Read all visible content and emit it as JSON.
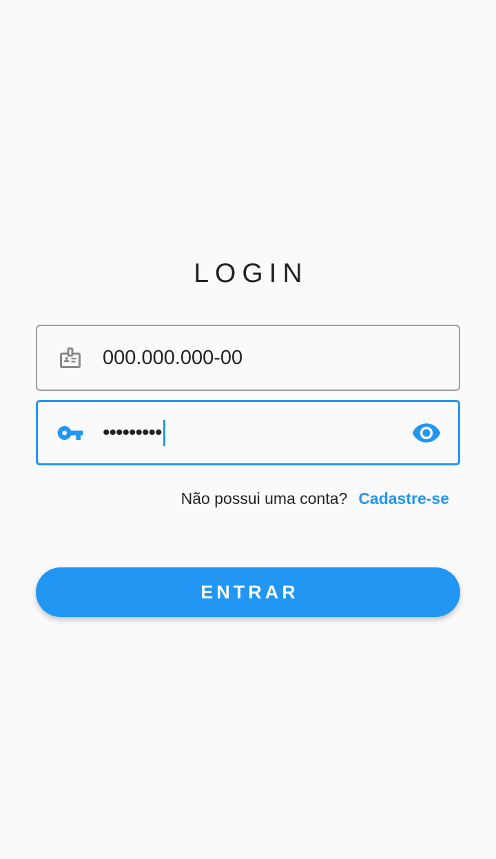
{
  "page": {
    "title": "LOGIN"
  },
  "form": {
    "cpf": {
      "value": "000.000.000-00",
      "icon": "badge-icon"
    },
    "password": {
      "masked_value": "•••••••••",
      "icon": "key-icon",
      "toggle_icon": "eye-icon",
      "focused": true
    },
    "signup_prompt": "Não possui uma conta?",
    "signup_link": "Cadastre-se",
    "submit_label": "ENTRAR"
  },
  "colors": {
    "accent": "#2196f3",
    "background": "#fafafa",
    "text": "#222222",
    "border_inactive": "#9e9e9e"
  }
}
